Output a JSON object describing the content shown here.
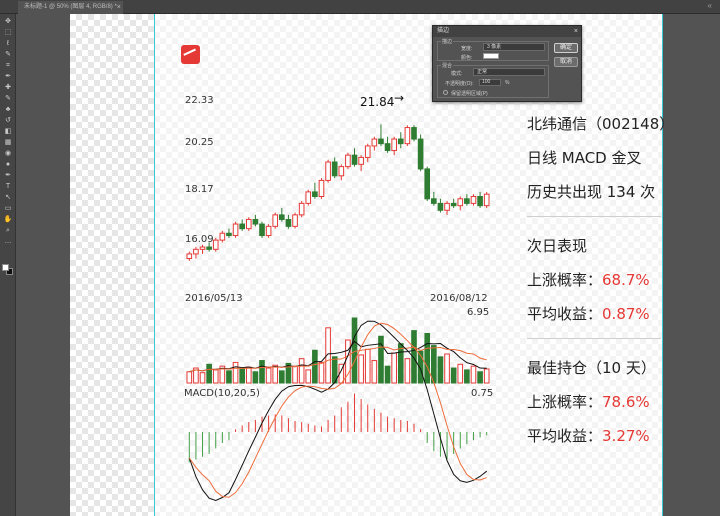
{
  "tabbar": {
    "tab_label": "未标题-1 @ 50% (图层 4, RGB/8) *",
    "close_glyph": "×",
    "window_arrows": "«"
  },
  "toolbar": {
    "tools": [
      "move-tool",
      "marquee-tool",
      "lasso-tool",
      "quick-select-tool",
      "crop-tool",
      "eyedropper-tool",
      "healing-tool",
      "brush-tool",
      "clone-stamp-tool",
      "history-brush-tool",
      "eraser-tool",
      "gradient-tool",
      "blur-tool",
      "dodge-tool",
      "pen-tool",
      "type-tool",
      "path-select-tool",
      "rectangle-tool",
      "hand-tool",
      "zoom-tool",
      "more-tools"
    ],
    "tool_glyphs": [
      "✥",
      "⬚",
      "ℓ",
      "✎",
      "⌗",
      "✒",
      "✚",
      "✎",
      "♣",
      "↺",
      "◧",
      "▦",
      "◉",
      "●",
      "✒",
      "T",
      "↖",
      "▭",
      "✋",
      "⌕",
      "…"
    ]
  },
  "dialog": {
    "title": "描边",
    "section_stroke": "描边",
    "width_label": "宽度:",
    "width_value": "3 像素",
    "color_label": "颜色:",
    "section_blend": "混合",
    "mode_label": "模式:",
    "mode_value": "正常",
    "opacity_label": "不透明度(O):",
    "opacity_value": "100",
    "opacity_unit": "%",
    "preserve_label": "保留透明区域(P)",
    "ok_label": "确定",
    "cancel_label": "取消"
  },
  "chart_labels": {
    "price_ticks": [
      "22.33",
      "20.25",
      "18.17",
      "16.09"
    ],
    "high_annotation": "21.84",
    "high_arrow": "→",
    "date_start": "2016/05/13",
    "date_end": "2016/08/12",
    "volume_max": "6.95",
    "macd_title": "MACD(10,20,5)",
    "macd_value": "0.75"
  },
  "colors": {
    "up": "#e53935",
    "down": "#2e7d32",
    "ma_short": "#111111",
    "ma_long": "#ef6c3a",
    "accent": "#e53935"
  },
  "chart_data": [
    {
      "type": "candlestick",
      "title": "",
      "x": [
        "2016/05/13",
        "2016/08/12"
      ],
      "ylim": [
        15.5,
        22.9
      ],
      "y_ticks": [
        22.33,
        20.25,
        18.17,
        16.09
      ],
      "annotation": {
        "label": "21.84",
        "value": 21.84
      },
      "candles": [
        [
          16.0,
          16.3,
          15.9,
          16.2
        ],
        [
          16.2,
          16.5,
          16.0,
          16.4
        ],
        [
          16.4,
          16.6,
          16.2,
          16.5
        ],
        [
          16.5,
          16.7,
          16.3,
          16.4
        ],
        [
          16.4,
          16.9,
          16.3,
          16.8
        ],
        [
          16.8,
          17.2,
          16.7,
          17.1
        ],
        [
          17.1,
          17.3,
          16.9,
          17.0
        ],
        [
          17.0,
          17.6,
          16.9,
          17.5
        ],
        [
          17.5,
          17.7,
          17.2,
          17.3
        ],
        [
          17.3,
          17.8,
          17.2,
          17.7
        ],
        [
          17.7,
          17.9,
          17.4,
          17.5
        ],
        [
          17.5,
          17.6,
          16.9,
          17.0
        ],
        [
          17.0,
          17.5,
          16.9,
          17.4
        ],
        [
          17.4,
          18.0,
          17.3,
          17.9
        ],
        [
          17.9,
          18.2,
          17.6,
          17.7
        ],
        [
          17.7,
          17.9,
          17.3,
          17.4
        ],
        [
          17.4,
          18.0,
          17.3,
          17.9
        ],
        [
          17.9,
          18.5,
          17.8,
          18.4
        ],
        [
          18.4,
          19.0,
          18.3,
          18.9
        ],
        [
          18.9,
          19.3,
          18.6,
          18.7
        ],
        [
          18.7,
          19.5,
          18.6,
          19.4
        ],
        [
          19.4,
          20.3,
          19.3,
          20.2
        ],
        [
          20.2,
          20.4,
          19.5,
          19.6
        ],
        [
          19.6,
          20.1,
          19.4,
          20.0
        ],
        [
          20.0,
          20.6,
          19.9,
          20.5
        ],
        [
          20.5,
          20.8,
          20.0,
          20.1
        ],
        [
          20.1,
          20.5,
          19.8,
          20.4
        ],
        [
          20.4,
          21.0,
          20.2,
          20.9
        ],
        [
          20.9,
          21.3,
          20.7,
          21.2
        ],
        [
          21.2,
          21.84,
          20.9,
          21.0
        ],
        [
          21.0,
          21.3,
          20.6,
          20.7
        ],
        [
          20.7,
          21.3,
          20.5,
          21.2
        ],
        [
          21.2,
          21.5,
          20.8,
          21.0
        ],
        [
          21.0,
          21.8,
          20.9,
          21.7
        ],
        [
          21.7,
          21.8,
          21.1,
          21.2
        ],
        [
          21.2,
          21.4,
          19.8,
          19.9
        ],
        [
          19.9,
          20.0,
          18.5,
          18.6
        ],
        [
          18.6,
          18.9,
          18.3,
          18.4
        ],
        [
          18.4,
          18.6,
          18.0,
          18.1
        ],
        [
          18.1,
          18.5,
          17.9,
          18.4
        ],
        [
          18.4,
          18.6,
          18.2,
          18.3
        ],
        [
          18.3,
          18.7,
          18.1,
          18.6
        ],
        [
          18.6,
          18.8,
          18.3,
          18.4
        ],
        [
          18.4,
          18.8,
          18.3,
          18.7
        ],
        [
          18.7,
          18.9,
          18.2,
          18.3
        ],
        [
          18.3,
          18.9,
          18.2,
          18.8
        ]
      ]
    },
    {
      "type": "bar",
      "title": "",
      "max_label": "6.95",
      "values": [
        1.2,
        1.6,
        1.1,
        2.0,
        1.4,
        1.8,
        1.3,
        2.2,
        1.5,
        1.7,
        1.2,
        2.4,
        1.6,
        1.9,
        1.3,
        2.1,
        1.8,
        2.6,
        1.4,
        3.5,
        2.2,
        5.9,
        2.8,
        2.0,
        4.6,
        6.95,
        3.0,
        3.6,
        2.4,
        5.0,
        1.8,
        3.2,
        4.2,
        2.6,
        5.6,
        3.4,
        5.3,
        4.0,
        2.8,
        3.1,
        1.6,
        2.0,
        1.4,
        1.8,
        1.2,
        1.5
      ]
    },
    {
      "type": "bar",
      "title": "MACD(10,20,5)",
      "last_label": "0.75",
      "values": [
        -0.55,
        -0.5,
        -0.45,
        -0.4,
        -0.3,
        -0.2,
        -0.15,
        0.05,
        0.12,
        0.18,
        0.22,
        0.28,
        0.3,
        0.32,
        0.3,
        0.25,
        0.2,
        0.18,
        0.15,
        0.12,
        0.1,
        0.22,
        0.3,
        0.45,
        0.55,
        0.7,
        0.6,
        0.5,
        0.42,
        0.35,
        0.28,
        0.25,
        0.22,
        0.2,
        0.15,
        0.05,
        -0.2,
        -0.35,
        -0.45,
        -0.5,
        -0.4,
        -0.3,
        -0.22,
        -0.15,
        -0.1,
        -0.06
      ]
    }
  ],
  "stats": {
    "stock_name": "北纬通信（002148）",
    "signal": "日线 MACD 金叉",
    "history": "历史共出现 134 次",
    "next_day_title": "次日表现",
    "up_prob_label": "上涨概率：",
    "up_prob_value": "68.7%",
    "avg_return_label": "平均收益：",
    "avg_return_value": "0.87%",
    "best_hold_title": "最佳持仓（10 天）",
    "best_up_prob_label": "上涨概率：",
    "best_up_prob_value": "78.6%",
    "best_avg_return_label": "平均收益：",
    "best_avg_return_value": "3.27%"
  }
}
